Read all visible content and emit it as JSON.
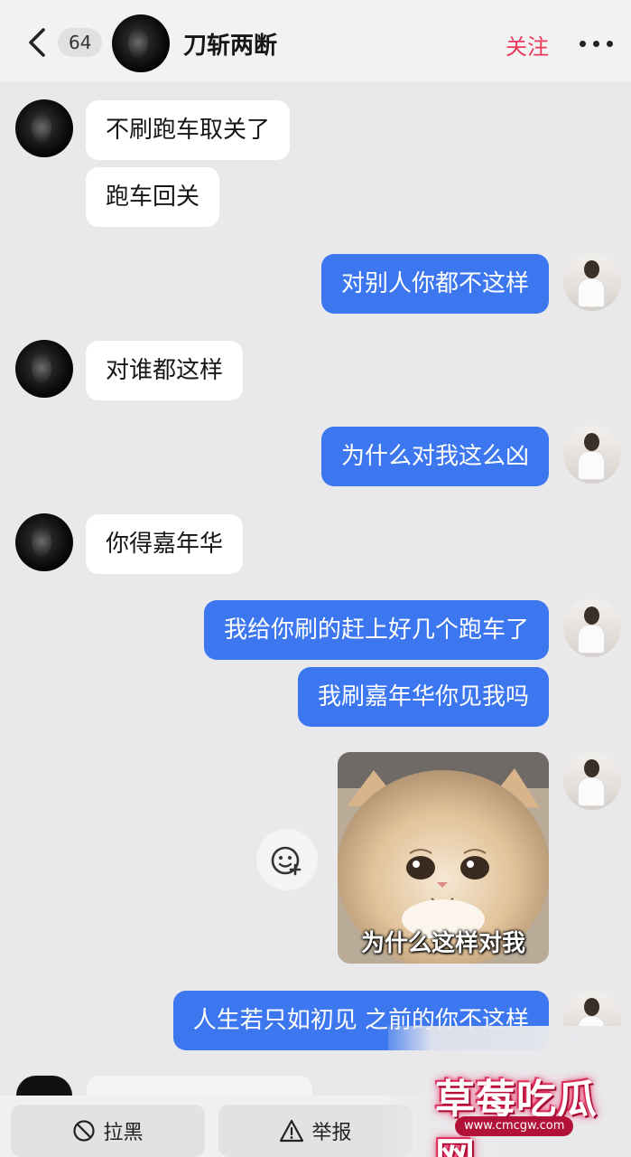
{
  "header": {
    "back_icon": "chevron-left-icon",
    "unread_count": "64",
    "contact_name": "刀斩两断",
    "follow_label": "关注",
    "more_icon": "more-horizontal-icon"
  },
  "messages": [
    {
      "side": "in",
      "text": "不刷跑车取关了"
    },
    {
      "side": "in",
      "text": "跑车回关"
    },
    {
      "side": "out",
      "text": "对别人你都不这样"
    },
    {
      "side": "in",
      "text": "对谁都这样"
    },
    {
      "side": "out",
      "text": "为什么对我这么凶"
    },
    {
      "side": "in",
      "text": "你得嘉年华"
    },
    {
      "side": "out",
      "text": "我给你刷的赶上好几个跑车了"
    },
    {
      "side": "out",
      "text": "我刷嘉年华你见我吗"
    },
    {
      "side": "out",
      "type": "sticker",
      "caption": "为什么这样对我"
    },
    {
      "side": "out",
      "text": "人生若只如初见 之前的你不这样"
    }
  ],
  "reaction_icon": "add-emoji-icon",
  "bottom_bar": {
    "block_label": "拉黑",
    "block_icon": "block-icon",
    "report_label": "举报",
    "report_icon": "warning-icon"
  },
  "watermark": {
    "text": "草莓吃瓜网",
    "url": "www.cmcgw.com"
  },
  "colors": {
    "outgoing_bubble": "#3c77f0",
    "incoming_bubble": "#ffffff",
    "follow_accent": "#ea3a5a",
    "background": "#e9e9ec"
  }
}
